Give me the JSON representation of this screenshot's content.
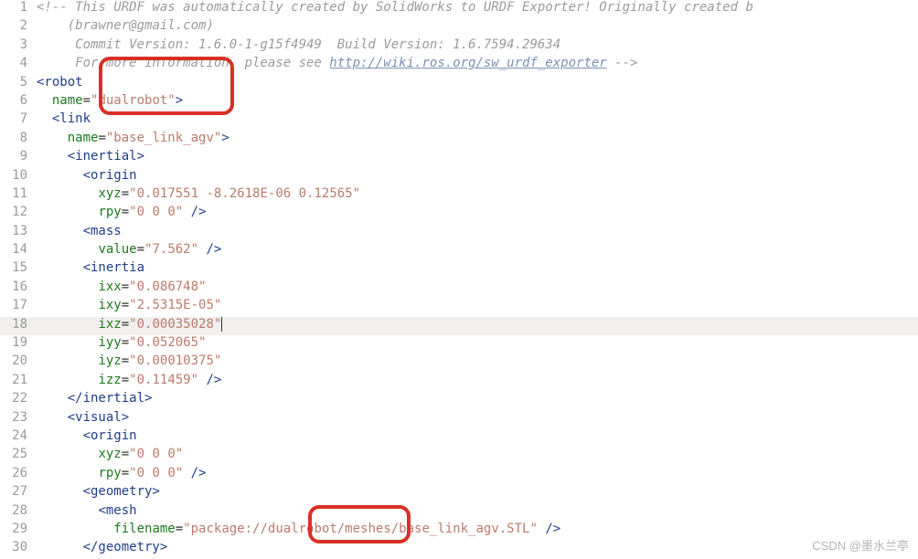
{
  "watermark": "CSDN @墨水兰亭",
  "lines": [
    {
      "n": 1,
      "tokens": [
        {
          "t": "<!-- This URDF was automatically created by SolidWorks to URDF Exporter! Originally created b",
          "c": "cm"
        }
      ]
    },
    {
      "n": 2,
      "tokens": [
        {
          "t": "    (",
          "c": "cm"
        },
        {
          "t": "brawner@gmail.com",
          "c": "cm"
        },
        {
          "t": ")",
          "c": "cm"
        }
      ]
    },
    {
      "n": 3,
      "tokens": [
        {
          "t": "     Commit Version: 1.6.0-1-g15f4949  Build Version: 1.6.7594.29634",
          "c": "cm"
        }
      ]
    },
    {
      "n": 4,
      "tokens": [
        {
          "t": "     For more information, please see ",
          "c": "cm"
        },
        {
          "t": "http://wiki.ros.org/sw_urdf_exporter",
          "c": "url"
        },
        {
          "t": " -->",
          "c": "cm"
        }
      ]
    },
    {
      "n": 5,
      "tokens": [
        {
          "t": "<robot",
          "c": "tag"
        }
      ]
    },
    {
      "n": 6,
      "tokens": [
        {
          "t": "  ",
          "c": ""
        },
        {
          "t": "name",
          "c": "attr"
        },
        {
          "t": "=",
          "c": ""
        },
        {
          "t": "\"dualrobot\"",
          "c": "str"
        },
        {
          "t": ">",
          "c": "tag"
        }
      ]
    },
    {
      "n": 7,
      "tokens": [
        {
          "t": "  ",
          "c": ""
        },
        {
          "t": "<link",
          "c": "tag"
        }
      ]
    },
    {
      "n": 8,
      "tokens": [
        {
          "t": "    ",
          "c": ""
        },
        {
          "t": "name",
          "c": "attr"
        },
        {
          "t": "=",
          "c": ""
        },
        {
          "t": "\"base_link_agv\"",
          "c": "str"
        },
        {
          "t": ">",
          "c": "tag"
        }
      ]
    },
    {
      "n": 9,
      "tokens": [
        {
          "t": "    ",
          "c": ""
        },
        {
          "t": "<inertial>",
          "c": "tag"
        }
      ]
    },
    {
      "n": 10,
      "tokens": [
        {
          "t": "      ",
          "c": ""
        },
        {
          "t": "<origin",
          "c": "tag"
        }
      ]
    },
    {
      "n": 11,
      "tokens": [
        {
          "t": "        ",
          "c": ""
        },
        {
          "t": "xyz",
          "c": "attr"
        },
        {
          "t": "=",
          "c": ""
        },
        {
          "t": "\"0.017551 -8.2618E-06 0.12565\"",
          "c": "str"
        }
      ]
    },
    {
      "n": 12,
      "tokens": [
        {
          "t": "        ",
          "c": ""
        },
        {
          "t": "rpy",
          "c": "attr"
        },
        {
          "t": "=",
          "c": ""
        },
        {
          "t": "\"0 0 0\"",
          "c": "str"
        },
        {
          "t": " />",
          "c": "tag"
        }
      ]
    },
    {
      "n": 13,
      "tokens": [
        {
          "t": "      ",
          "c": ""
        },
        {
          "t": "<mass",
          "c": "tag"
        }
      ]
    },
    {
      "n": 14,
      "tokens": [
        {
          "t": "        ",
          "c": ""
        },
        {
          "t": "value",
          "c": "attr"
        },
        {
          "t": "=",
          "c": ""
        },
        {
          "t": "\"7.562\"",
          "c": "str"
        },
        {
          "t": " />",
          "c": "tag"
        }
      ]
    },
    {
      "n": 15,
      "tokens": [
        {
          "t": "      ",
          "c": ""
        },
        {
          "t": "<inertia",
          "c": "tag"
        }
      ]
    },
    {
      "n": 16,
      "tokens": [
        {
          "t": "        ",
          "c": ""
        },
        {
          "t": "ixx",
          "c": "attr"
        },
        {
          "t": "=",
          "c": ""
        },
        {
          "t": "\"0.086748\"",
          "c": "str"
        }
      ]
    },
    {
      "n": 17,
      "tokens": [
        {
          "t": "        ",
          "c": ""
        },
        {
          "t": "ixy",
          "c": "attr"
        },
        {
          "t": "=",
          "c": ""
        },
        {
          "t": "\"2.5315E-05\"",
          "c": "str"
        }
      ]
    },
    {
      "n": 18,
      "hl": true,
      "tokens": [
        {
          "t": "        ",
          "c": ""
        },
        {
          "t": "ixz",
          "c": "attr"
        },
        {
          "t": "=",
          "c": ""
        },
        {
          "t": "\"0.00035028\"",
          "c": "str"
        },
        {
          "t": "",
          "c": "cursor"
        }
      ]
    },
    {
      "n": 19,
      "tokens": [
        {
          "t": "        ",
          "c": ""
        },
        {
          "t": "iyy",
          "c": "attr"
        },
        {
          "t": "=",
          "c": ""
        },
        {
          "t": "\"0.052065\"",
          "c": "str"
        }
      ]
    },
    {
      "n": 20,
      "tokens": [
        {
          "t": "        ",
          "c": ""
        },
        {
          "t": "iyz",
          "c": "attr"
        },
        {
          "t": "=",
          "c": ""
        },
        {
          "t": "\"0.00010375\"",
          "c": "str"
        }
      ]
    },
    {
      "n": 21,
      "tokens": [
        {
          "t": "        ",
          "c": ""
        },
        {
          "t": "izz",
          "c": "attr"
        },
        {
          "t": "=",
          "c": ""
        },
        {
          "t": "\"0.11459\"",
          "c": "str"
        },
        {
          "t": " />",
          "c": "tag"
        }
      ]
    },
    {
      "n": 22,
      "tokens": [
        {
          "t": "    ",
          "c": ""
        },
        {
          "t": "</inertial>",
          "c": "tag"
        }
      ]
    },
    {
      "n": 23,
      "tokens": [
        {
          "t": "    ",
          "c": ""
        },
        {
          "t": "<visual>",
          "c": "tag"
        }
      ]
    },
    {
      "n": 24,
      "tokens": [
        {
          "t": "      ",
          "c": ""
        },
        {
          "t": "<origin",
          "c": "tag"
        }
      ]
    },
    {
      "n": 25,
      "tokens": [
        {
          "t": "        ",
          "c": ""
        },
        {
          "t": "xyz",
          "c": "attr"
        },
        {
          "t": "=",
          "c": ""
        },
        {
          "t": "\"0 0 0\"",
          "c": "str"
        }
      ]
    },
    {
      "n": 26,
      "tokens": [
        {
          "t": "        ",
          "c": ""
        },
        {
          "t": "rpy",
          "c": "attr"
        },
        {
          "t": "=",
          "c": ""
        },
        {
          "t": "\"0 0 0\"",
          "c": "str"
        },
        {
          "t": " />",
          "c": "tag"
        }
      ]
    },
    {
      "n": 27,
      "tokens": [
        {
          "t": "      ",
          "c": ""
        },
        {
          "t": "<geometry>",
          "c": "tag"
        }
      ]
    },
    {
      "n": 28,
      "tokens": [
        {
          "t": "        ",
          "c": ""
        },
        {
          "t": "<mesh",
          "c": "tag"
        }
      ]
    },
    {
      "n": 29,
      "tokens": [
        {
          "t": "          ",
          "c": ""
        },
        {
          "t": "filename",
          "c": "attr"
        },
        {
          "t": "=",
          "c": ""
        },
        {
          "t": "\"package://dualrobot/meshes/base_link_agv.STL\"",
          "c": "str"
        },
        {
          "t": " />",
          "c": "tag"
        }
      ]
    },
    {
      "n": 30,
      "tokens": [
        {
          "t": "      ",
          "c": ""
        },
        {
          "t": "</geometry>",
          "c": "tag"
        }
      ]
    }
  ]
}
